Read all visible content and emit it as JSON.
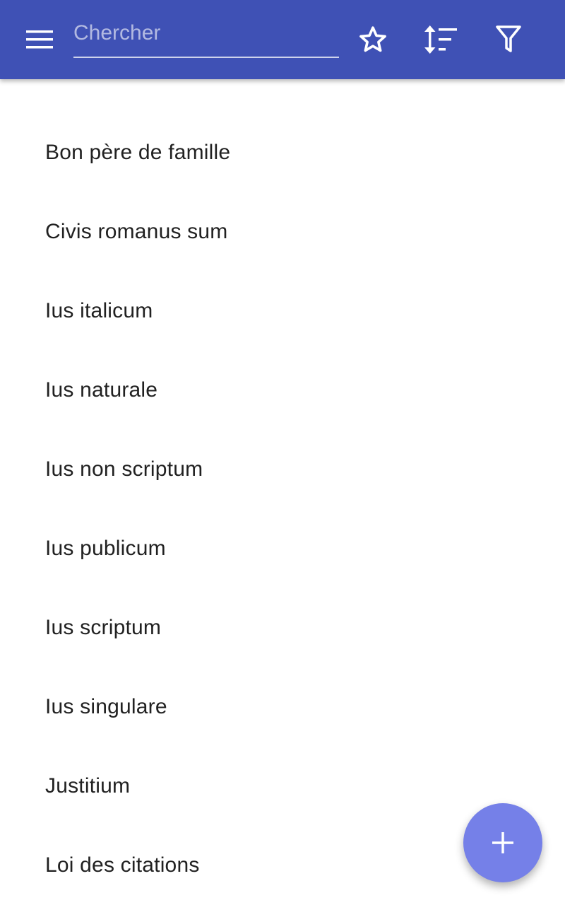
{
  "toolbar": {
    "menu_icon": "hamburger-menu-icon",
    "search": {
      "placeholder": "Chercher",
      "value": ""
    },
    "actions": [
      {
        "icon": "star-outline-icon"
      },
      {
        "icon": "sort-icon"
      },
      {
        "icon": "filter-icon"
      }
    ],
    "background_color": "#3f51b5"
  },
  "list": {
    "items": [
      {
        "label": "Bon père de famille"
      },
      {
        "label": "Civis romanus sum"
      },
      {
        "label": "Ius italicum"
      },
      {
        "label": "Ius naturale"
      },
      {
        "label": "Ius non scriptum"
      },
      {
        "label": "Ius publicum"
      },
      {
        "label": "Ius scriptum"
      },
      {
        "label": "Ius singulare"
      },
      {
        "label": "Justitium"
      },
      {
        "label": "Loi des citations"
      }
    ]
  },
  "fab": {
    "icon": "plus-icon",
    "color": "#7580e8"
  }
}
